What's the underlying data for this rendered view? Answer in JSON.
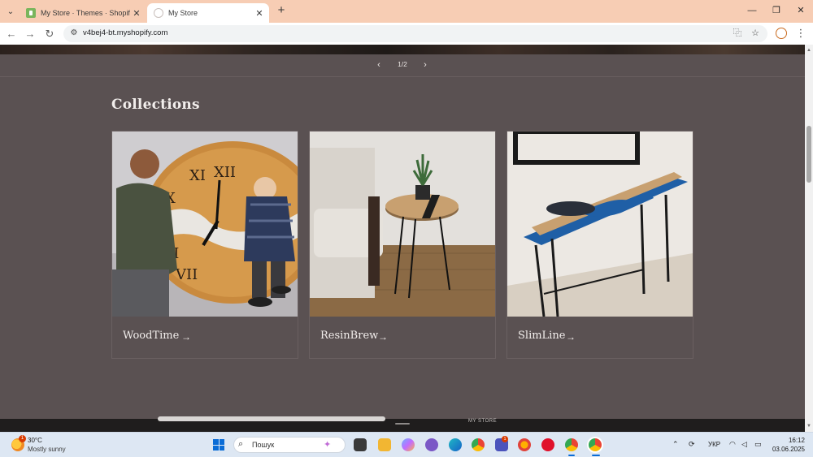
{
  "browser": {
    "tabs": [
      {
        "title": "My Store · Themes · Shopify",
        "active": false
      },
      {
        "title": "My Store",
        "active": true
      }
    ],
    "url": "v4bej4-bt.myshopify.com"
  },
  "slider": {
    "counter": "1/2"
  },
  "collections": {
    "heading": "Collections",
    "items": [
      {
        "label": "WoodTime"
      },
      {
        "label": "ResinBrew"
      },
      {
        "label": "SlimLine"
      }
    ]
  },
  "footer": {
    "brand": "MY STORE"
  },
  "taskbar": {
    "weather": {
      "temp": "30°C",
      "desc": "Mostly sunny",
      "badge": "1"
    },
    "search_placeholder": "Пошук",
    "teams_badge": "1",
    "language": "УКР",
    "time": "16:12",
    "date": "03.06.2025"
  },
  "colors": {
    "page_background": "#5a5152",
    "tab_bar": "#f7cdb4",
    "taskbar": "#dde7f3"
  }
}
